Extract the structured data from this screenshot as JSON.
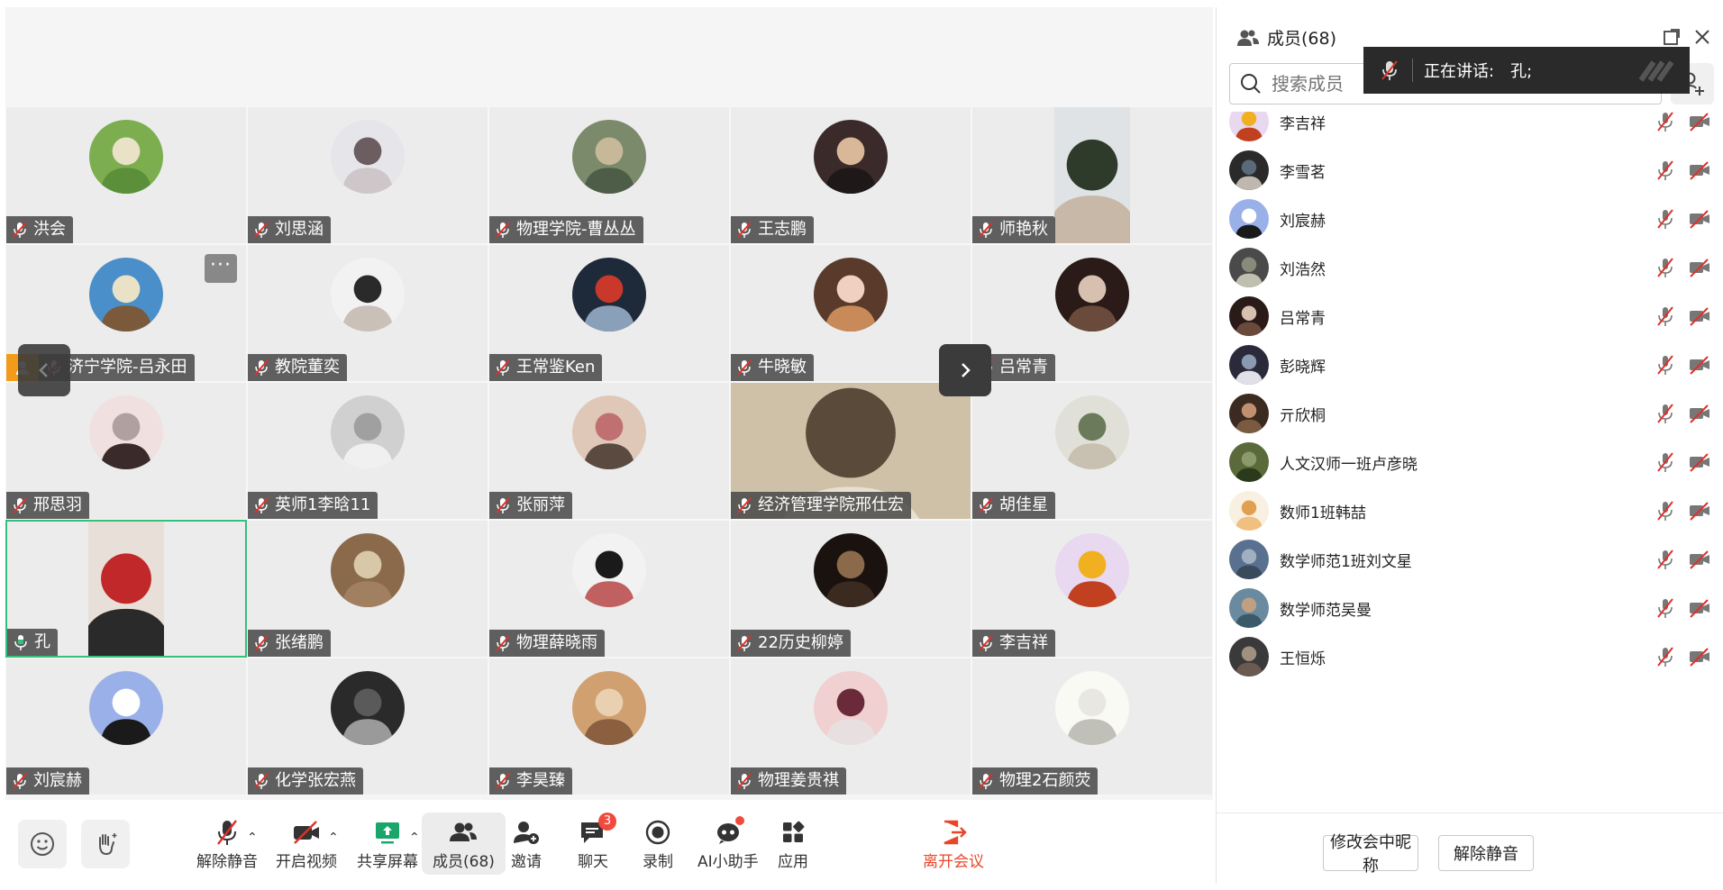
{
  "grid": {
    "tiles": [
      {
        "name": "洪会",
        "av": [
          "#7cae4f",
          "#e9e2c6",
          "#5b8f3a"
        ]
      },
      {
        "name": "刘思涵",
        "av": [
          "#e6e6ea",
          "#6b5d60",
          "#cfc6c9"
        ]
      },
      {
        "name": "物理学院-曹丛丛",
        "av": [
          "#7a8a6a",
          "#c8b89a",
          "#4e5d48"
        ]
      },
      {
        "name": "王志鹏",
        "av": [
          "#3a2a2a",
          "#d9b89a",
          "#1e1818"
        ]
      },
      {
        "name": "师艳秋",
        "video": true,
        "av": [
          "#dfe3e6",
          "#2e3a2a",
          "#c8b8a8"
        ]
      },
      {
        "name": "济宁学院-吕永田",
        "host": true,
        "more": true,
        "av": [
          "#4a8fc9",
          "#e9e2c6",
          "#7a5a3a"
        ]
      },
      {
        "name": "教院董奕",
        "av": [
          "#f2f2f2",
          "#2a2a2a",
          "#c9c0b8"
        ]
      },
      {
        "name": "王常鉴Ken",
        "av": [
          "#1e2a3a",
          "#c9382a",
          "#8aa0b8"
        ]
      },
      {
        "name": "牛晓敏",
        "av": [
          "#5a3a2a",
          "#f0d0c0",
          "#c98a5a"
        ]
      },
      {
        "name": "吕常青",
        "av": [
          "#2a1a18",
          "#d8c0b0",
          "#6a4a3a"
        ]
      },
      {
        "name": "邢思羽",
        "av": [
          "#f0e0e0",
          "#b0a0a0",
          "#3a2a2a"
        ]
      },
      {
        "name": "英师1李晗11",
        "av": [
          "#d0d0d0",
          "#a0a0a0",
          "#f0f0f0"
        ]
      },
      {
        "name": "张丽萍",
        "av": [
          "#e0c8b8",
          "#c07070",
          "#5a4a40"
        ]
      },
      {
        "name": "经济管理学院邢仕宏",
        "wide": true,
        "av": [
          "#cfc0a8",
          "#5a4a3a",
          "#e8e0d0"
        ]
      },
      {
        "name": "胡佳星",
        "av": [
          "#e0e0d8",
          "#6a7a5a",
          "#c8c0b0"
        ]
      },
      {
        "name": "孔",
        "active": true,
        "speaking": true,
        "video": true,
        "av": [
          "#e8e0d8",
          "#c0282a",
          "#2a2a2a"
        ]
      },
      {
        "name": "张绪鹏",
        "av": [
          "#8a6a4a",
          "#d8c8a8",
          "#a08060"
        ]
      },
      {
        "name": "物理薛晓雨",
        "av": [
          "#f2f2f2",
          "#1a1a1a",
          "#c06060"
        ]
      },
      {
        "name": "22历史柳婷",
        "av": [
          "#1a120e",
          "#8a6a4a",
          "#3a2a20"
        ]
      },
      {
        "name": "李吉祥",
        "av": [
          "#e8d8f0",
          "#f0b020",
          "#c04020"
        ]
      },
      {
        "name": "刘宸赫",
        "av": [
          "#9ab0e8",
          "#ffffff",
          "#1a1a1a"
        ]
      },
      {
        "name": "化学张宏燕",
        "av": [
          "#2a2a2a",
          "#5a5a5a",
          "#9a9a9a"
        ]
      },
      {
        "name": "李昊臻",
        "av": [
          "#d0a070",
          "#e8d0b0",
          "#8a6040"
        ]
      },
      {
        "name": "物理姜贵祺",
        "av": [
          "#f0d0d0",
          "#6a2a3a",
          "#e8e0e0"
        ]
      },
      {
        "name": "物理2石颜荧",
        "av": [
          "#fafaf5",
          "#e8e8e0",
          "#c0c0b8"
        ]
      }
    ],
    "prev_icon": "chevron-left-icon",
    "next_icon": "chevron-right-icon"
  },
  "toolbar": {
    "unmute": "解除静音",
    "start_video": "开启视频",
    "share_screen": "共享屏幕",
    "members": "成员(68)",
    "invite": "邀请",
    "chat": "聊天",
    "chat_badge": "3",
    "record": "录制",
    "ai_assistant": "AI小助手",
    "apps": "应用",
    "leave": "离开会议"
  },
  "speaking": {
    "label": "正在讲话:",
    "name": "孔;"
  },
  "panel": {
    "title": "成员(68)",
    "search_placeholder": "搜索成员",
    "members": [
      {
        "name": "李吉祥",
        "av": [
          "#e8d8f0",
          "#f0b020",
          "#c04020"
        ]
      },
      {
        "name": "李雪茗",
        "av": [
          "#2a2a2a",
          "#5a6a7a",
          "#c0b8b0"
        ]
      },
      {
        "name": "刘宸赫",
        "av": [
          "#9ab0e8",
          "#ffffff",
          "#1a1a1a"
        ]
      },
      {
        "name": "刘浩然",
        "av": [
          "#4a4a4a",
          "#8a8a7a",
          "#c0c0b0"
        ]
      },
      {
        "name": "吕常青",
        "av": [
          "#2a1a18",
          "#d8c0b0",
          "#6a4a3a"
        ]
      },
      {
        "name": "彭晓辉",
        "av": [
          "#2a2a3a",
          "#8a9ab0",
          "#e0e0e8"
        ]
      },
      {
        "name": "亓欣桐",
        "av": [
          "#3a2a20",
          "#c09070",
          "#7a5a40"
        ]
      },
      {
        "name": "人文汉师一班卢彦晓",
        "av": [
          "#5a6a3a",
          "#8a9a6a",
          "#2a3a1a"
        ]
      },
      {
        "name": "数师1班韩喆",
        "av": [
          "#f8f0e0",
          "#e0a050",
          "#f0c080"
        ]
      },
      {
        "name": "数学师范1班刘文星",
        "av": [
          "#5a7090",
          "#a0b0c0",
          "#3a4a5a"
        ]
      },
      {
        "name": "数学师范吴曼",
        "av": [
          "#6a8aa0",
          "#c0a080",
          "#3a5a6a"
        ]
      },
      {
        "name": "王恒烁",
        "av": [
          "#3a3a3a",
          "#a09080",
          "#6a5a50"
        ]
      }
    ],
    "rename_button": "修改会中昵称",
    "unmute_button": "解除静音"
  },
  "colors": {
    "active_border": "#33c07a",
    "host_badge": "#f29b1a",
    "leave": "#e8462a",
    "badge": "#f04a3e"
  }
}
